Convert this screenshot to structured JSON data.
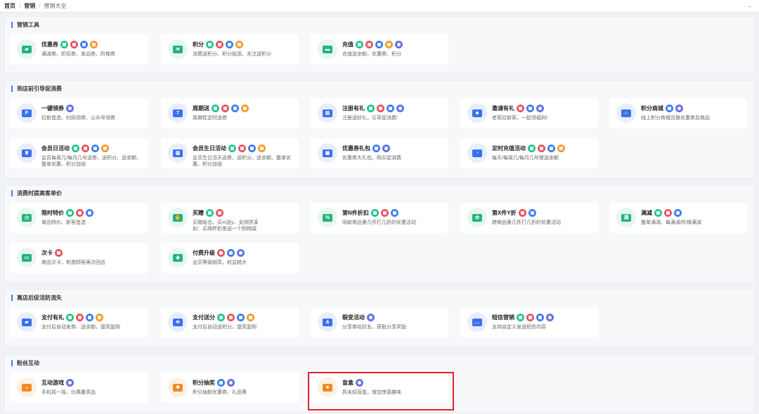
{
  "breadcrumb": {
    "home": "首页",
    "sep": "/",
    "marketing": "营销",
    "current": "营销大全"
  },
  "back_glyph": "←",
  "sections": [
    {
      "title": "营销工具",
      "cards": [
        {
          "name": "优惠券",
          "desc": "满减券、折扣券、单品券、阶梯券",
          "icon": "ticket-icon",
          "bg": "#e5f7ef",
          "fg": "#25b37b",
          "badges": [
            "g",
            "r",
            "b",
            "o"
          ]
        },
        {
          "name": "积分",
          "desc": "消费送积分、积分抵现、关注送积分",
          "icon": "coins-icon",
          "bg": "#e5f7ef",
          "fg": "#25b37b",
          "badges": [
            "g",
            "r",
            "b",
            "o"
          ]
        },
        {
          "name": "充值",
          "desc": "充值送余额、优惠券、积分",
          "icon": "wallet-icon",
          "bg": "#e5f7ef",
          "fg": "#25b37b",
          "badges": [
            "g",
            "r",
            "b",
            "o",
            "p"
          ]
        }
      ]
    },
    {
      "title": "到店前引导促消费",
      "cards": [
        {
          "name": "一键领券",
          "desc": "拉新首选、扫码领券、公众号领券",
          "icon": "parking-icon",
          "bg": "#e8eefe",
          "fg": "#3a6ff0",
          "badges": [
            "p"
          ]
        },
        {
          "name": "周期送",
          "desc": "周期性定时送券",
          "icon": "calendar-icon",
          "bg": "#e8eefe",
          "fg": "#3a6ff0",
          "badges": [
            "g",
            "r",
            "b",
            "o"
          ]
        },
        {
          "name": "注册有礼",
          "desc": "注册送好礼，引导促消费!",
          "icon": "register-icon",
          "bg": "#e8eefe",
          "fg": "#3a6ff0",
          "badges": [
            "g",
            "r",
            "b",
            "p"
          ]
        },
        {
          "name": "邀请有礼",
          "desc": "老客拉新客，一起领福利!",
          "icon": "invite-icon",
          "bg": "#e8eefe",
          "fg": "#3a6ff0",
          "badges": [
            "r",
            "b",
            "p"
          ]
        },
        {
          "name": "积分商城",
          "desc": "线上积分商城兑换优惠券及商品",
          "icon": "store-icon",
          "bg": "#e8eefe",
          "fg": "#3a6ff0",
          "badges": [
            "b",
            "p"
          ]
        },
        {
          "name": "会员日活动",
          "desc": "会员每周几/每月几号送券、送积分、送余额、整单优惠、积分加倍",
          "icon": "crown-icon",
          "bg": "#e8eefe",
          "fg": "#3a6ff0",
          "badges": [
            "g",
            "r",
            "b",
            "o"
          ]
        },
        {
          "name": "会员生日活动",
          "desc": "会员生日当天送券、送积分、送余额、整单优惠、积分加倍",
          "icon": "cake-icon",
          "bg": "#e8eefe",
          "fg": "#3a6ff0",
          "badges": [
            "g",
            "r",
            "b",
            "o"
          ]
        },
        {
          "name": "优惠券礼包",
          "desc": "优惠券大礼包，购买促消费",
          "icon": "gift-pack-icon",
          "bg": "#e8eefe",
          "fg": "#3a6ff0",
          "badges": [
            "b",
            "p"
          ]
        },
        {
          "name": "定时充值活动",
          "desc": "每天/每周几/每月几号赠送余额",
          "icon": "timer-icon",
          "bg": "#e8eefe",
          "fg": "#3a6ff0",
          "badges": [
            "g",
            "r",
            "b",
            "o"
          ]
        }
      ]
    },
    {
      "title": "消费时提高客单价",
      "cards": [
        {
          "name": "限时特价",
          "desc": "单品特价、新客首选",
          "icon": "alarm-icon",
          "bg": "#e5f7ef",
          "fg": "#25b37b",
          "badges": [
            "g",
            "r",
            "b"
          ]
        },
        {
          "name": "买赠",
          "desc": "买赠结合、买m送y、支持拼凑\n如：买两杯奶茶送一个购物袋",
          "icon": "hand-gift-icon",
          "bg": "#e5f7ef",
          "fg": "#25b37b",
          "badges": [
            "g",
            "r"
          ]
        },
        {
          "name": "第N件折扣",
          "desc": "同款商品第几件打几折的优惠活动",
          "icon": "percent-icon",
          "bg": "#e5f7ef",
          "fg": "#25b37b",
          "badges": [
            "g",
            "r",
            "b"
          ]
        },
        {
          "name": "第X件Y折",
          "desc": "跨商品第几件打几折的优惠活动",
          "icon": "badge-discount-icon",
          "bg": "#e5f7ef",
          "fg": "#25b37b",
          "badges": [
            "r",
            "b"
          ]
        },
        {
          "name": "满减",
          "desc": "整单满减、每满减/阶梯满减",
          "icon": "full-reduce-icon",
          "bg": "#e5f7ef",
          "fg": "#25b37b",
          "badges": [
            "g",
            "r",
            "b"
          ]
        },
        {
          "name": "次卡",
          "desc": "商品次卡，刺激顾客再次回店",
          "icon": "card-icon",
          "bg": "#e5f7ef",
          "fg": "#25b37b",
          "badges": [
            "r"
          ]
        },
        {
          "name": "付费升级",
          "desc": "会员等级越高，权益越大",
          "icon": "upgrade-icon",
          "bg": "#e5f7ef",
          "fg": "#25b37b",
          "badges": [
            "r",
            "b",
            "p"
          ]
        }
      ]
    },
    {
      "title": "离店后促活防流失",
      "cards": [
        {
          "name": "支付有礼",
          "desc": "支付后自动发券、送余额，提高复购",
          "icon": "pay-gift-icon",
          "bg": "#e8eefe",
          "fg": "#3a6ff0",
          "badges": [
            "g",
            "r",
            "b",
            "o"
          ]
        },
        {
          "name": "支付送分",
          "desc": "支付后自动送积分，提高复购",
          "icon": "pay-points-icon",
          "bg": "#e8eefe",
          "fg": "#3a6ff0",
          "badges": [
            "g",
            "r",
            "b",
            "o"
          ]
        },
        {
          "name": "裂变活动",
          "desc": "分享券给好友，获取分享奖励",
          "icon": "share-icon",
          "bg": "#e8eefe",
          "fg": "#3a6ff0",
          "badges": [
            "p"
          ]
        },
        {
          "name": "短信营销",
          "desc": "支持自定义发送短信内容",
          "icon": "sms-icon",
          "bg": "#e8eefe",
          "fg": "#3a6ff0",
          "badges": [
            "g",
            "r",
            "b",
            "p"
          ]
        }
      ]
    },
    {
      "title": "粉丝互动",
      "cards": [
        {
          "name": "互动游戏",
          "desc": "手机摇一摇、比赛赢奖品",
          "icon": "gamepad-icon",
          "bg": "#fdf0e3",
          "fg": "#f08a24",
          "badges": [
            "p"
          ]
        },
        {
          "name": "积分抽奖",
          "desc": "积分抽取优惠券、礼品等",
          "icon": "lottery-icon",
          "bg": "#fdf0e3",
          "fg": "#f08a24",
          "badges": [
            "b",
            "p"
          ]
        },
        {
          "name": "盲盒",
          "desc": "拆未知盲盒，增加惊喜趣味",
          "icon": "blind-box-icon",
          "bg": "#fdf0e3",
          "fg": "#f08a24",
          "badges": [
            "p"
          ]
        }
      ]
    }
  ],
  "icon_glyphs": {
    "ticket-icon": "▰",
    "coins-icon": "≋",
    "wallet-icon": "▬",
    "parking-icon": "P",
    "calendar-icon": "7",
    "register-icon": "▤",
    "invite-icon": "☻",
    "store-icon": "⌂",
    "crown-icon": "♛",
    "cake-icon": "▥",
    "gift-pack-icon": "▣",
    "timer-icon": "◔",
    "alarm-icon": "◷",
    "hand-gift-icon": "✋",
    "percent-icon": "%",
    "badge-discount-icon": "✿",
    "full-reduce-icon": "满",
    "card-icon": "▭",
    "upgrade-icon": "◆",
    "pay-gift-icon": "▰",
    "pay-points-icon": "≋",
    "share-icon": "⋔",
    "sms-icon": "…",
    "gamepad-icon": "◒",
    "lottery-icon": "✱",
    "blind-box-icon": "■"
  }
}
